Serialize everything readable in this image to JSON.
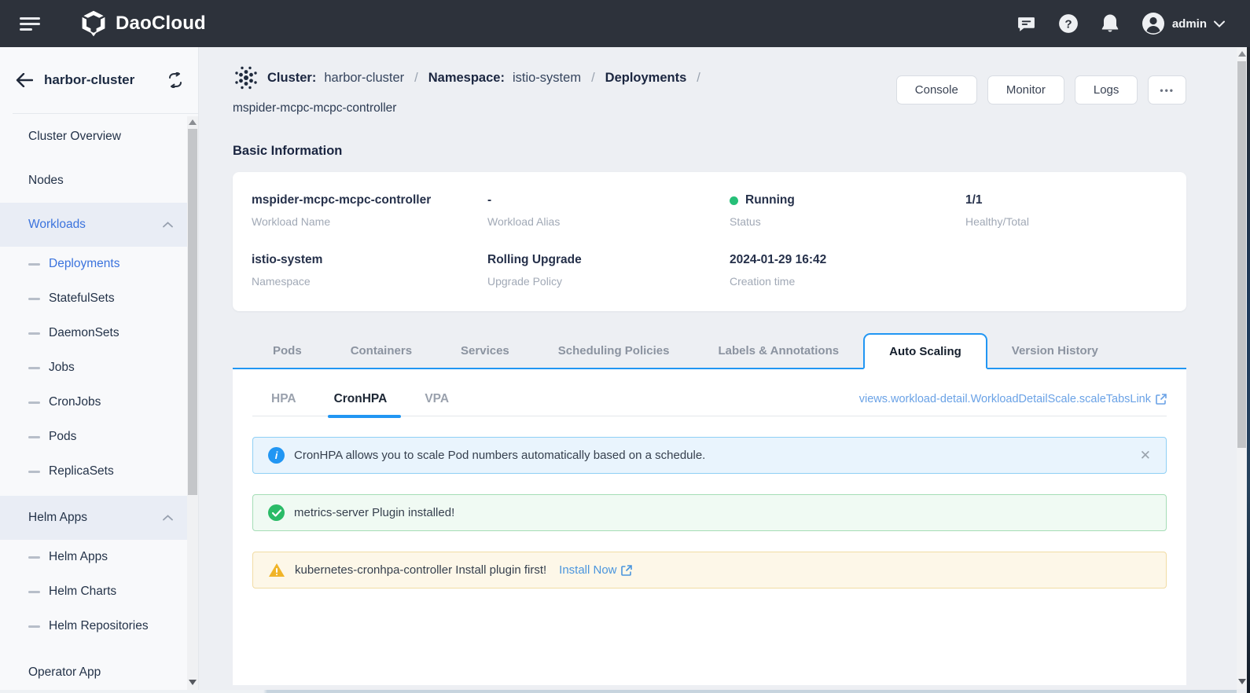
{
  "header": {
    "brand": "DaoCloud",
    "user": "admin"
  },
  "sidebar": {
    "title": "harbor-cluster",
    "items": [
      {
        "label": "Cluster Overview"
      },
      {
        "label": "Nodes"
      },
      {
        "label": "Workloads"
      },
      {
        "label": "Deployments"
      },
      {
        "label": "StatefulSets"
      },
      {
        "label": "DaemonSets"
      },
      {
        "label": "Jobs"
      },
      {
        "label": "CronJobs"
      },
      {
        "label": "Pods"
      },
      {
        "label": "ReplicaSets"
      },
      {
        "label": "Helm Apps"
      },
      {
        "label": "Helm Apps"
      },
      {
        "label": "Helm Charts"
      },
      {
        "label": "Helm Repositories"
      },
      {
        "label": "Operator App"
      }
    ]
  },
  "breadcrumb": {
    "cluster_label": "Cluster:",
    "cluster_value": "harbor-cluster",
    "namespace_label": "Namespace:",
    "namespace_value": "istio-system",
    "section": "Deployments",
    "separator": "/",
    "resource": "mspider-mcpc-mcpc-controller"
  },
  "actions": {
    "console": "Console",
    "monitor": "Monitor",
    "logs": "Logs",
    "more": "•••"
  },
  "basic_info": {
    "title": "Basic Information",
    "workload_name": {
      "value": "mspider-mcpc-mcpc-controller",
      "label": "Workload Name"
    },
    "workload_alias": {
      "value": "-",
      "label": "Workload Alias"
    },
    "status": {
      "value": "Running",
      "label": "Status"
    },
    "healthy_total": {
      "value": "1/1",
      "label": "Healthy/Total"
    },
    "namespace": {
      "value": "istio-system",
      "label": "Namespace"
    },
    "upgrade_policy": {
      "value": "Rolling Upgrade",
      "label": "Upgrade Policy"
    },
    "creation_time": {
      "value": "2024-01-29 16:42",
      "label": "Creation time"
    }
  },
  "tabs": [
    {
      "label": "Pods"
    },
    {
      "label": "Containers"
    },
    {
      "label": "Services"
    },
    {
      "label": "Scheduling Policies"
    },
    {
      "label": "Labels & Annotations"
    },
    {
      "label": "Auto Scaling"
    },
    {
      "label": "Version History"
    }
  ],
  "scale_tabs": {
    "subtabs": [
      {
        "label": "HPA"
      },
      {
        "label": "CronHPA"
      },
      {
        "label": "VPA"
      }
    ],
    "link": "views.workload-detail.WorkloadDetailScale.scaleTabsLink"
  },
  "alerts": {
    "info": {
      "text": "CronHPA allows you to scale Pod numbers automatically based on a schedule.",
      "close": "✕"
    },
    "success": {
      "text": "metrics-server Plugin installed!"
    },
    "warning": {
      "text": "kubernetes-cronhpa-controller Install plugin first!",
      "link": "Install Now"
    }
  },
  "colors": {
    "accent_blue": "#2196f3",
    "sidebar_link_blue": "#3b73dd",
    "status_running_green": "#26bf78",
    "info_icon": "#2196f3",
    "success_icon": "#2abb67",
    "warning_icon": "#f0b428",
    "header_bg": "#2d323b"
  }
}
